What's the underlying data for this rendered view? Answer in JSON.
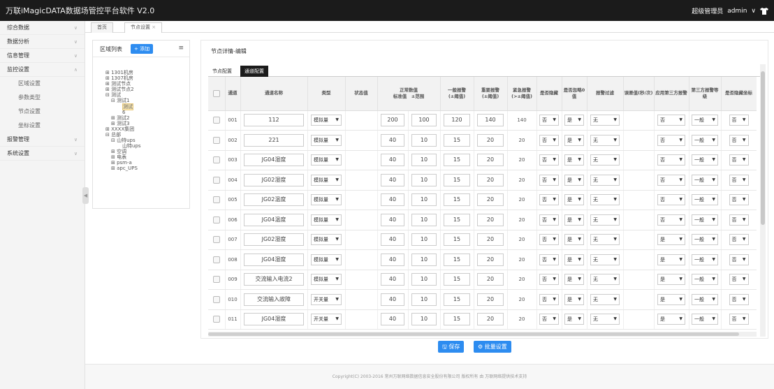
{
  "app_title": "万联iMagicDATA数据场管控平台软件 V2.0",
  "user": {
    "role": "超级管理员",
    "name": "admin",
    "dropdown_glyph": "∨"
  },
  "nav": [
    {
      "label": "综合数据",
      "chev": "∨"
    },
    {
      "label": "数据分析",
      "chev": "∨"
    },
    {
      "label": "信息管理",
      "chev": "∨"
    },
    {
      "label": "监控设置",
      "chev": "∧"
    },
    {
      "label": "区域设置"
    },
    {
      "label": "参数类型"
    },
    {
      "label": "节点设置"
    },
    {
      "label": "坐标设置"
    },
    {
      "label": "报警管理",
      "chev": "∨"
    },
    {
      "label": "系统设置",
      "chev": "∨"
    }
  ],
  "tabs": [
    {
      "label": "首页"
    },
    {
      "label": "节点设置",
      "close": "×"
    }
  ],
  "tree": {
    "title": "区域列表",
    "add_label": "+ 添加",
    "menu_glyph": "≡",
    "items": [
      "⊞ 1301机房",
      "⊞ 1307机房",
      "⊞ 测试节点",
      "⊞ 测试节点2",
      "⊟ 测试",
      "⊟ 测试1",
      "测试",
      "6",
      "⊞ 测试2",
      "⊞ 测试3",
      "⊞ XXXX集团",
      "⊟ 总部",
      "⊟ 山特ups",
      "山特ups",
      "⊞ 空调",
      "⊞ 电表",
      "⊞ psm-a",
      "⊞ apc_UPS"
    ]
  },
  "detail": {
    "title": "节点详情-编辑",
    "tabs": [
      "节点配置",
      "通道配置"
    ],
    "headers": {
      "channel": "通道",
      "name": "通道名称",
      "type": "类型",
      "state_value": "状态值",
      "normal": "正常数值",
      "std": "标准值",
      "range": "±范围",
      "alarm1": "一般报警\n(±阈值)",
      "alarm2": "重要报警\n(±阈值)",
      "alarm3": "紧急报警\n(>±阈值)",
      "hidden": "是否隐藏",
      "ignore0": "是否忽略0值",
      "filter": "报警过滤",
      "err": "误差值(秒/次)",
      "third": "应用第三方报警",
      "level": "第三方报警等级",
      "coord": "是否隐藏坐标"
    },
    "rows": [
      {
        "ch": "001",
        "name": "112",
        "type": "模拟量",
        "std": "200",
        "rng": "100",
        "a1": "120",
        "a2": "140",
        "a3": "140",
        "hide": "否",
        "ign": "是",
        "flt": "无",
        "third": "否",
        "lvl": "一般",
        "coord": "否"
      },
      {
        "ch": "002",
        "name": "221",
        "type": "模拟量",
        "std": "40",
        "rng": "10",
        "a1": "15",
        "a2": "20",
        "a3": "20",
        "hide": "否",
        "ign": "是",
        "flt": "无",
        "third": "否",
        "lvl": "一般",
        "coord": "否"
      },
      {
        "ch": "003",
        "name": "JG04湿度",
        "type": "模拟量",
        "std": "40",
        "rng": "10",
        "a1": "15",
        "a2": "20",
        "a3": "20",
        "hide": "否",
        "ign": "是",
        "flt": "无",
        "third": "否",
        "lvl": "一般",
        "coord": "否"
      },
      {
        "ch": "004",
        "name": "JG02湿度",
        "type": "模拟量",
        "std": "40",
        "rng": "10",
        "a1": "15",
        "a2": "20",
        "a3": "20",
        "hide": "否",
        "ign": "是",
        "flt": "无",
        "third": "否",
        "lvl": "一般",
        "coord": "否"
      },
      {
        "ch": "005",
        "name": "JG02温度",
        "type": "模拟量",
        "std": "40",
        "rng": "10",
        "a1": "15",
        "a2": "20",
        "a3": "20",
        "hide": "否",
        "ign": "是",
        "flt": "无",
        "third": "否",
        "lvl": "一般",
        "coord": "否"
      },
      {
        "ch": "006",
        "name": "JG04温度",
        "type": "模拟量",
        "std": "40",
        "rng": "10",
        "a1": "15",
        "a2": "20",
        "a3": "20",
        "hide": "否",
        "ign": "是",
        "flt": "无",
        "third": "否",
        "lvl": "一般",
        "coord": "否"
      },
      {
        "ch": "007",
        "name": "JG02湿度",
        "type": "模拟量",
        "std": "40",
        "rng": "10",
        "a1": "15",
        "a2": "20",
        "a3": "20",
        "hide": "否",
        "ign": "是",
        "flt": "无",
        "third": "是",
        "lvl": "一般",
        "coord": "否"
      },
      {
        "ch": "008",
        "name": "JG04湿度",
        "type": "模拟量",
        "std": "40",
        "rng": "10",
        "a1": "15",
        "a2": "20",
        "a3": "20",
        "hide": "否",
        "ign": "是",
        "flt": "无",
        "third": "是",
        "lvl": "一般",
        "coord": "否"
      },
      {
        "ch": "009",
        "name": "交流输入电流2",
        "type": "模拟量",
        "std": "40",
        "rng": "10",
        "a1": "15",
        "a2": "20",
        "a3": "20",
        "hide": "否",
        "ign": "是",
        "flt": "无",
        "third": "是",
        "lvl": "一般",
        "coord": "否"
      },
      {
        "ch": "010",
        "name": "交流输入故障",
        "type": "开关量",
        "std": "40",
        "rng": "10",
        "a1": "15",
        "a2": "20",
        "a3": "20",
        "hide": "否",
        "ign": "是",
        "flt": "无",
        "third": "是",
        "lvl": "一般",
        "coord": "否"
      },
      {
        "ch": "011",
        "name": "JG04湿度",
        "type": "开关量",
        "std": "40",
        "rng": "10",
        "a1": "15",
        "a2": "20",
        "a3": "20",
        "hide": "否",
        "ign": "是",
        "flt": "无",
        "third": "是",
        "lvl": "一般",
        "coord": "否"
      }
    ]
  },
  "buttons": {
    "save": "🖫 保存",
    "batch": "⚙ 批量设置"
  },
  "footer": "Copyright(C) 2003-2016 常州万联网络数据信息安全股份有限公司 版权所有 由 万联网络提供技术支持",
  "colors": {
    "accent": "#2d8cf0",
    "topbar": "#1b1b1b"
  }
}
